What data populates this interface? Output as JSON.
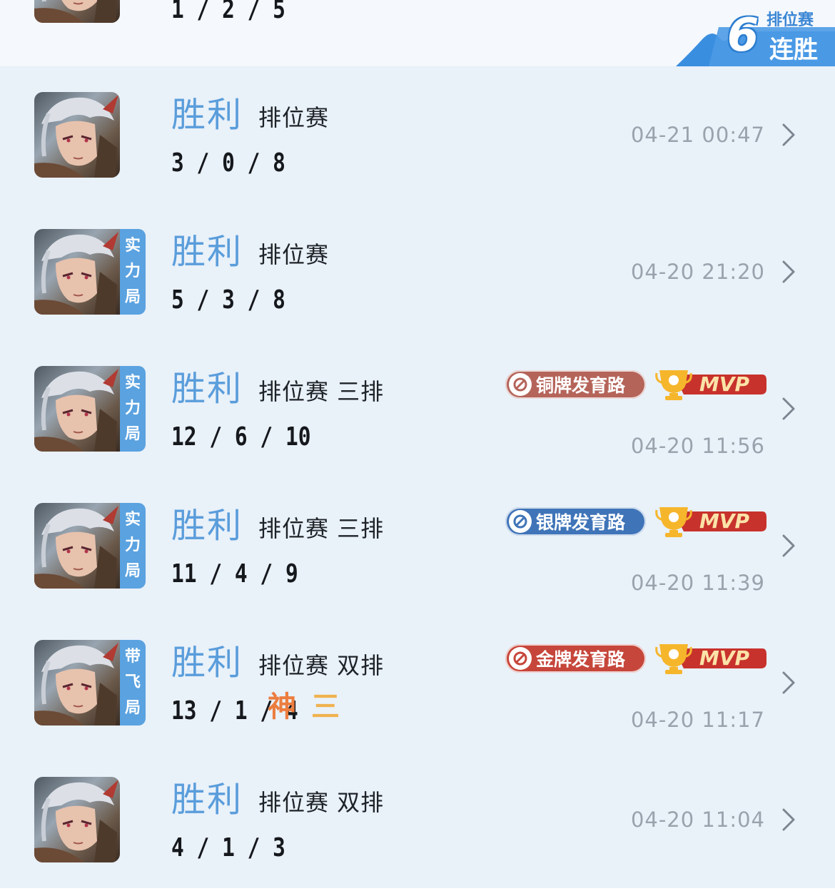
{
  "partial_top": {
    "kda": "1 / 2 / 5"
  },
  "streak_badge": {
    "number": "6",
    "mode": "排位赛",
    "label": "连胜"
  },
  "matches": [
    {
      "result": "胜利",
      "mode": "排位赛",
      "kda": "3 / 0 / 8",
      "time": "04-21 00:47"
    },
    {
      "result": "胜利",
      "mode": "排位赛",
      "kda": "5 / 3 / 8",
      "time": "04-20 21:20",
      "tag": [
        "实",
        "力",
        "局"
      ]
    },
    {
      "result": "胜利",
      "mode": "排位赛 三排",
      "kda": "12 / 6 / 10",
      "time": "04-20 11:56",
      "tag": [
        "实",
        "力",
        "局"
      ],
      "lane_badge": "铜牌发育路",
      "mvp": "MVP"
    },
    {
      "result": "胜利",
      "mode": "排位赛 三排",
      "kda": "11 / 4 / 9",
      "time": "04-20 11:39",
      "tag": [
        "实",
        "力",
        "局"
      ],
      "lane_badge": "银牌发育路",
      "mvp": "MVP"
    },
    {
      "result": "胜利",
      "mode": "排位赛 双排",
      "kda": "13 / 1 / 4",
      "extra_1": "神",
      "extra_2": "三",
      "time": "04-20 11:17",
      "tag": [
        "带",
        "飞",
        "局"
      ],
      "lane_badge": "金牌发育路",
      "mvp": "MVP"
    },
    {
      "result": "胜利",
      "mode": "排位赛 双排",
      "kda": "4 / 1 / 3",
      "time": "04-20 11:04"
    }
  ],
  "colors": {
    "result_text": "#5a9ddb",
    "list_background": "#e9f1f9",
    "tag_background": "#5aa2e0",
    "bronze_badge": "#b5645a",
    "silver_badge": "#3f74b8",
    "gold_badge": "#c6463b",
    "mvp_badge": "#c8322c"
  },
  "icons": {
    "avatar": "hero-portrait",
    "chevron": "chevron-right-icon",
    "lane": "lane-role-icon",
    "mvp": "trophy-icon"
  }
}
